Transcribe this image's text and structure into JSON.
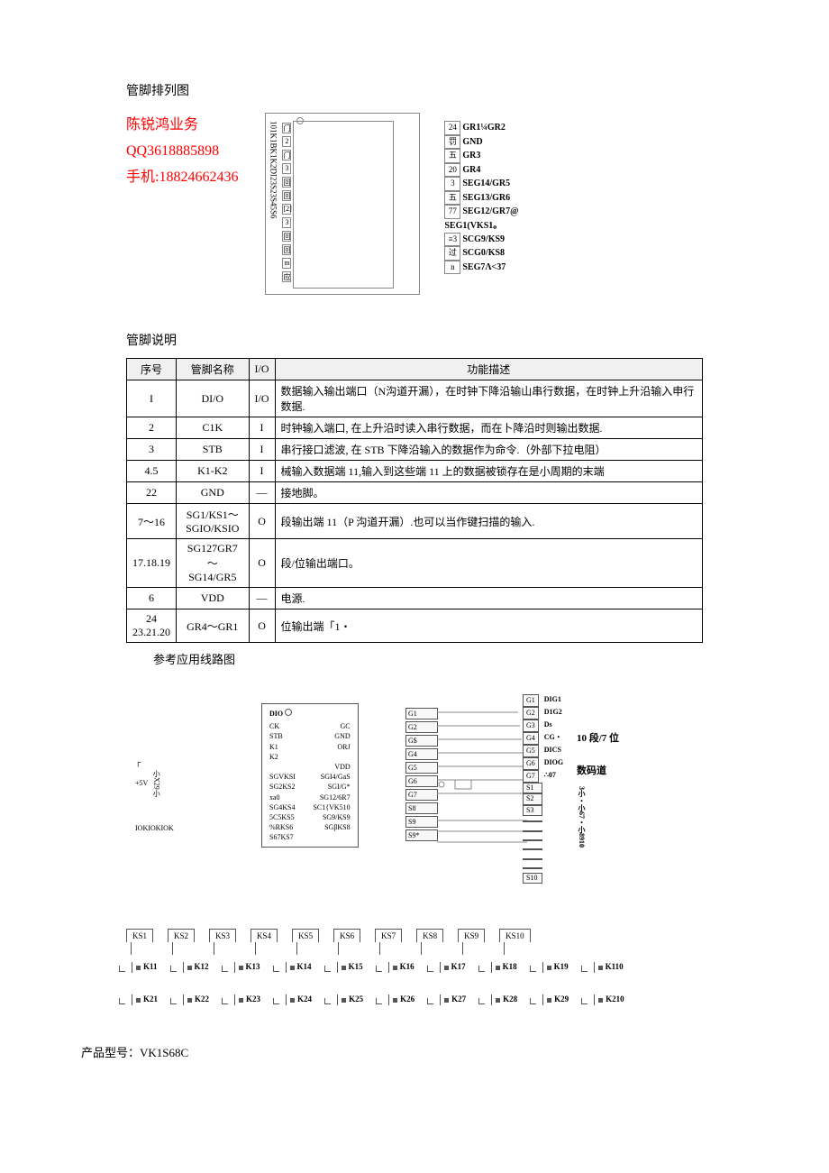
{
  "titles": {
    "pin_layout": "管脚排列图",
    "pin_desc": "管脚说明",
    "ref_circuit": "参考应用线路图",
    "product_model_label": "产品型号：",
    "product_model_value": "VK1S68C"
  },
  "contact": {
    "name": "陈锐鸿业务",
    "qq": "QQ3618885898",
    "phone": "手机:18824662436"
  },
  "chip_left_vert": "101K1BK1K2DI23S23S45S6",
  "chip_left_nums": [
    "门",
    "2",
    "门",
    "3",
    "回",
    "回",
    "[2]",
    "3",
    "回",
    "回",
    "m",
    "应"
  ],
  "chip_right": [
    {
      "num": "24",
      "label": "GR1¼GR2"
    },
    {
      "num": "罚",
      "label": "GND"
    },
    {
      "num": "五",
      "label": "GR3"
    },
    {
      "num": "20",
      "label": "GR4"
    },
    {
      "num": "3",
      "label": "SEG14/GR5"
    },
    {
      "num": "五",
      "label": "SEG13/GR6"
    },
    {
      "num": "77",
      "label": "SEG12/GR7@"
    },
    {
      "num": "",
      "label": "SEG1(VKS1。"
    },
    {
      "num": "≡3",
      "label": "SCG9/KS9"
    },
    {
      "num": "过",
      "label": "SCG0/KS8"
    },
    {
      "num": "n",
      "label": "SEG7Λ<37"
    }
  ],
  "table": {
    "headers": [
      "序号",
      "管脚名称",
      "I/O",
      "功能描述"
    ],
    "rows": [
      {
        "no": "I",
        "name": "DI/O",
        "io": "I/O",
        "desc": "数据输入输出端口（N沟道开漏），在时钟下降沿输山串行数据，在时钟上升沿输入申行数据."
      },
      {
        "no": "2",
        "name": "C1K",
        "io": "I",
        "desc": "时钟输入端口, 在上升沿时读入串行数据，而在卜降沿时则输出数据."
      },
      {
        "no": "3",
        "name": "STB",
        "io": "I",
        "desc": "串行接口滤波, 在 STB 下降沿输入的数据作为命令.（外部下拉电阻）"
      },
      {
        "no": "4.5",
        "name": "K1-K2",
        "io": "I",
        "desc": "械输入数据端 11,输入到这些端 11 上的数据被锁存在是小周期的末端"
      },
      {
        "no": "22",
        "name": "GND",
        "io": "—",
        "desc": "接地脚。"
      },
      {
        "no": "7～16",
        "name": "SG1/KS1～\nSGIO/KSIO",
        "io": "O",
        "desc": "段输出端 11（P 沟道开漏）.也可以当作键扫描的输入."
      },
      {
        "no": "17.18.19",
        "name": "SG127GR7～\nSG14/GR5",
        "io": "O",
        "desc": "段/位输出端口。"
      },
      {
        "no": "6",
        "name": "VDD",
        "io": "—",
        "desc": "电源."
      },
      {
        "no": "24\n23.21.20",
        "name": "GR4～GR1",
        "io": "O",
        "desc": "位输出端「1・"
      }
    ]
  },
  "circuit": {
    "left_supply": "+5V",
    "left_res_vert": "小X29小",
    "left_res_bot": "IOKIOKIOK",
    "dio": "DIO",
    "left_pins": [
      "CK",
      "STB",
      "K1",
      "K2",
      "",
      "SGVKSI",
      "SG2KS2",
      "xa0",
      "SG4KS4",
      "5C5KS5",
      "%RKS6",
      "S67KS7"
    ],
    "right_pins": [
      "GC",
      "GND",
      "ORJ",
      "",
      "VDD",
      "SGI4/GaS",
      "SGI/G*",
      "SG12/6R7",
      "SC1{VK510",
      "SG9/KS9",
      "SGβKS8"
    ],
    "g_boxes": [
      "G1",
      "G2",
      "G$",
      "G4",
      "G5",
      "G6",
      "G7",
      "S8",
      "S9",
      "S9*"
    ],
    "right_g": [
      "G1",
      "G2",
      "G3",
      "G4",
      "G5",
      "G6",
      "G7"
    ],
    "right_g_lbl": [
      "DIG1",
      "D1G2",
      "Ds",
      "CG・",
      "DICS",
      "DIOG",
      "∴07"
    ],
    "right_s": [
      "S1",
      "S2",
      "S3",
      "",
      "",
      "",
      "",
      "",
      "",
      "S10"
    ],
    "seg_label": "10 段/7 位",
    "digit_label": "数码道",
    "s_vert": "3小・小67・小8910"
  },
  "keys": {
    "row1": [
      "KS1",
      "KS2",
      "KS3",
      "KS4",
      "KS5",
      "KS6",
      "KS7",
      "KS8",
      "KS9",
      "KS10"
    ],
    "row2": [
      "K11",
      "K12",
      "K13",
      "K14",
      "K15",
      "K16",
      "K17",
      "K18",
      "K19",
      "K110"
    ],
    "row3": [
      "K21",
      "K22",
      "K23",
      "K24",
      "K25",
      "K26",
      "K27",
      "K28",
      "K29",
      "K210"
    ]
  }
}
